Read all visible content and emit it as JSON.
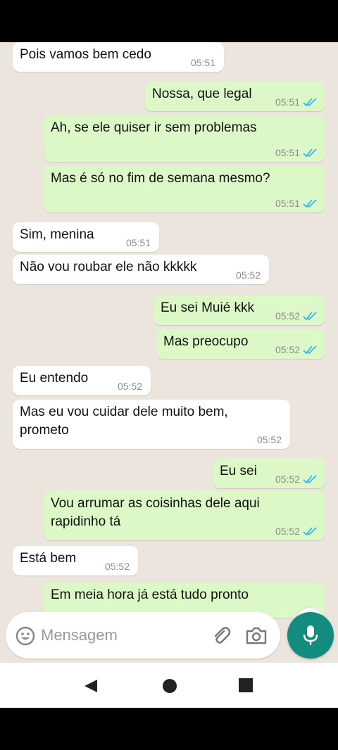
{
  "messages": [
    {
      "dir": "in",
      "text": "Pois vamos bem cedo",
      "time": "05:51"
    },
    {
      "dir": "out",
      "text": "Nossa, que legal",
      "time": "05:51"
    },
    {
      "dir": "out",
      "text": "Ah, se ele quiser ir sem problemas",
      "time": "05:51"
    },
    {
      "dir": "out",
      "text": "Mas é só no fim de semana mesmo?",
      "time": "05:51"
    },
    {
      "dir": "in",
      "text": "Sim, menina",
      "time": "05:51"
    },
    {
      "dir": "in",
      "text": "Não vou roubar ele não kkkkk",
      "time": "05:52"
    },
    {
      "dir": "out",
      "text": "Eu sei Muié kkk",
      "time": "05:52"
    },
    {
      "dir": "out",
      "text": "Mas preocupo",
      "time": "05:52"
    },
    {
      "dir": "in",
      "text": "Eu entendo",
      "time": "05:52"
    },
    {
      "dir": "in",
      "text": "Mas eu vou cuidar dele muito bem,\nprometo",
      "time": "05:52"
    },
    {
      "dir": "out",
      "text": "Eu sei",
      "time": "05:52"
    },
    {
      "dir": "out",
      "text": "Vou arrumar as coisinhas dele aqui\nrapidinho tá",
      "time": "05:52"
    },
    {
      "dir": "in",
      "text": "Está bem",
      "time": "05:52"
    },
    {
      "dir": "out",
      "text": "Em meia hora já está tudo pronto",
      "time": ""
    }
  ],
  "input": {
    "placeholder": "Mensagem"
  },
  "icons": {
    "emoji": "emoji-icon",
    "attach": "paperclip-icon",
    "camera": "camera-icon",
    "mic": "mic-icon",
    "scroll": "chevron-double-down-icon",
    "back": "nav-back-icon",
    "home": "nav-home-icon",
    "recent": "nav-recent-icon",
    "read": "double-check-icon"
  },
  "colors": {
    "incoming": "#ffffff",
    "outgoing": "#dcf8c6",
    "background": "#ece5dd",
    "accent": "#128c7e",
    "read_ticks": "#34b7f1"
  }
}
